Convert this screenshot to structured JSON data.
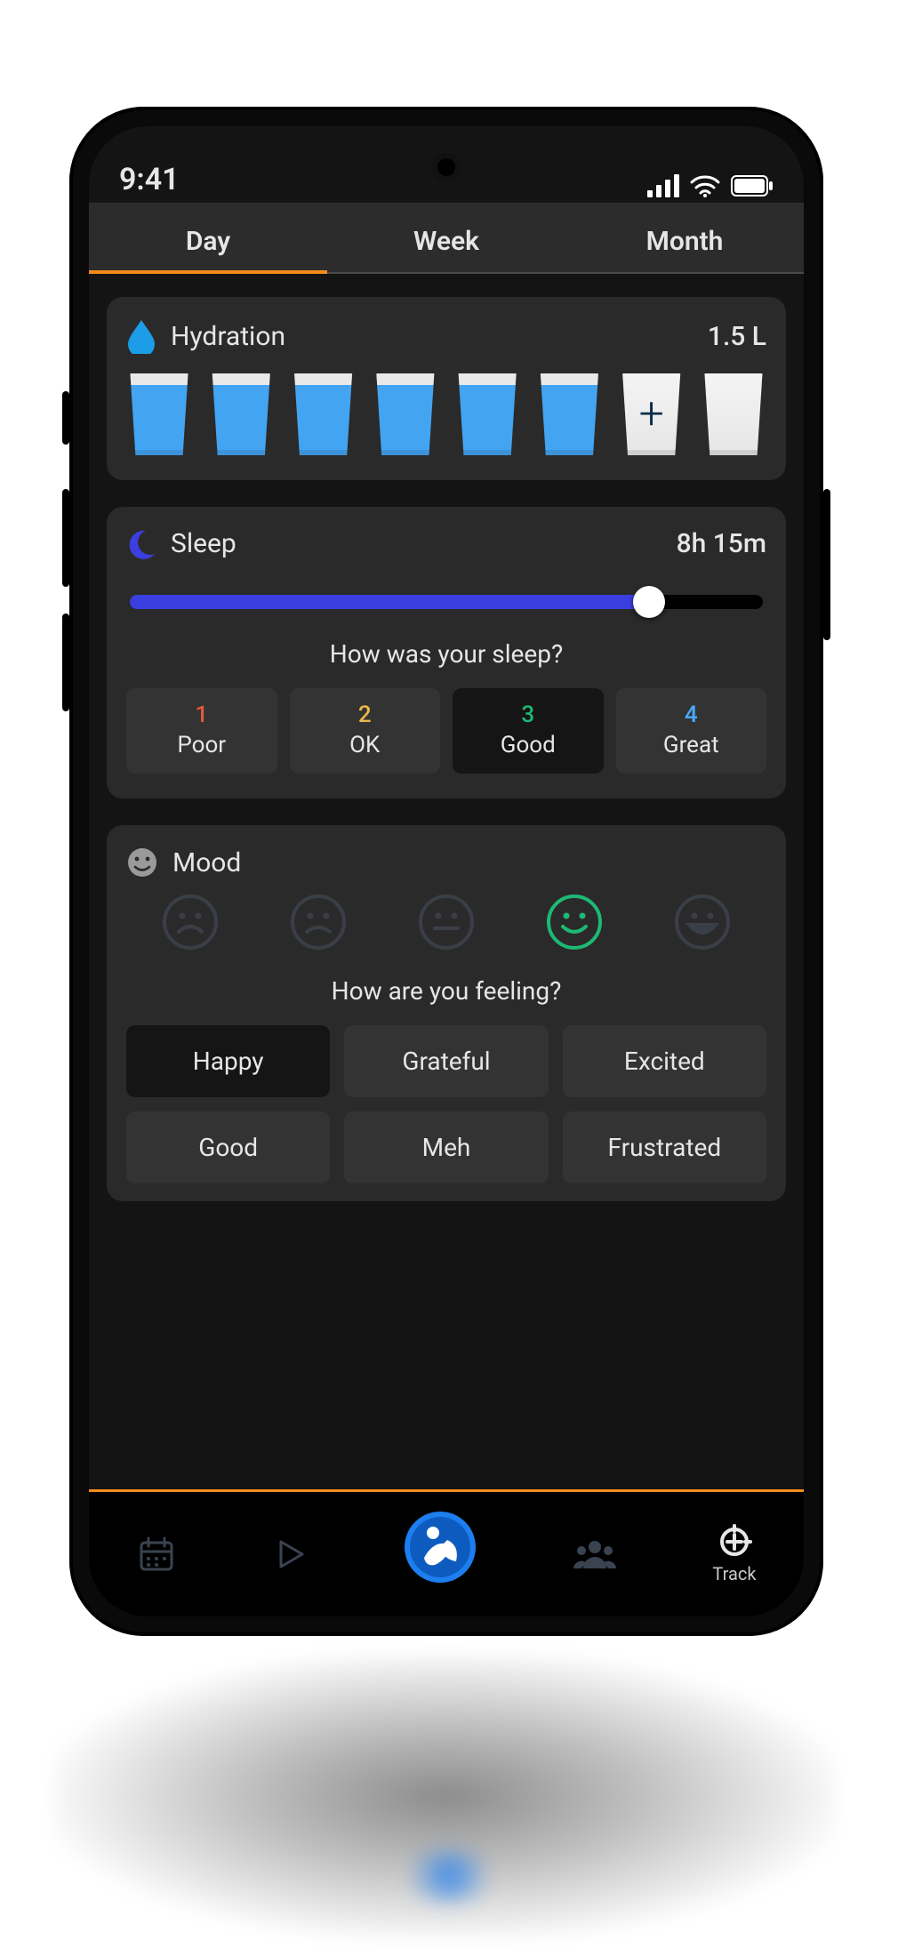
{
  "statusbar": {
    "time": "9:41"
  },
  "tabs": {
    "items": [
      "Day",
      "Week",
      "Month"
    ],
    "active_index": 0
  },
  "hydration": {
    "title": "Hydration",
    "value": "1.5 L",
    "cups_total": 8,
    "cups_filled": 6
  },
  "sleep": {
    "title": "Sleep",
    "value": "8h 15m",
    "slider_percent": 82,
    "question": "How was your sleep?",
    "ratings": [
      {
        "num": "1",
        "label": "Poor",
        "color": "#e25b3a"
      },
      {
        "num": "2",
        "label": "OK",
        "color": "#e9b949"
      },
      {
        "num": "3",
        "label": "Good",
        "color": "#1db974"
      },
      {
        "num": "4",
        "label": "Great",
        "color": "#4aa8ff"
      }
    ],
    "selected_rating_index": 2
  },
  "mood": {
    "title": "Mood",
    "selected_face_index": 3,
    "question": "How are you feeling?",
    "chips": [
      "Happy",
      "Grateful",
      "Excited",
      "Good",
      "Meh",
      "Frustrated"
    ],
    "selected_chip_index": 0
  },
  "nav": {
    "track_label": "Track"
  }
}
